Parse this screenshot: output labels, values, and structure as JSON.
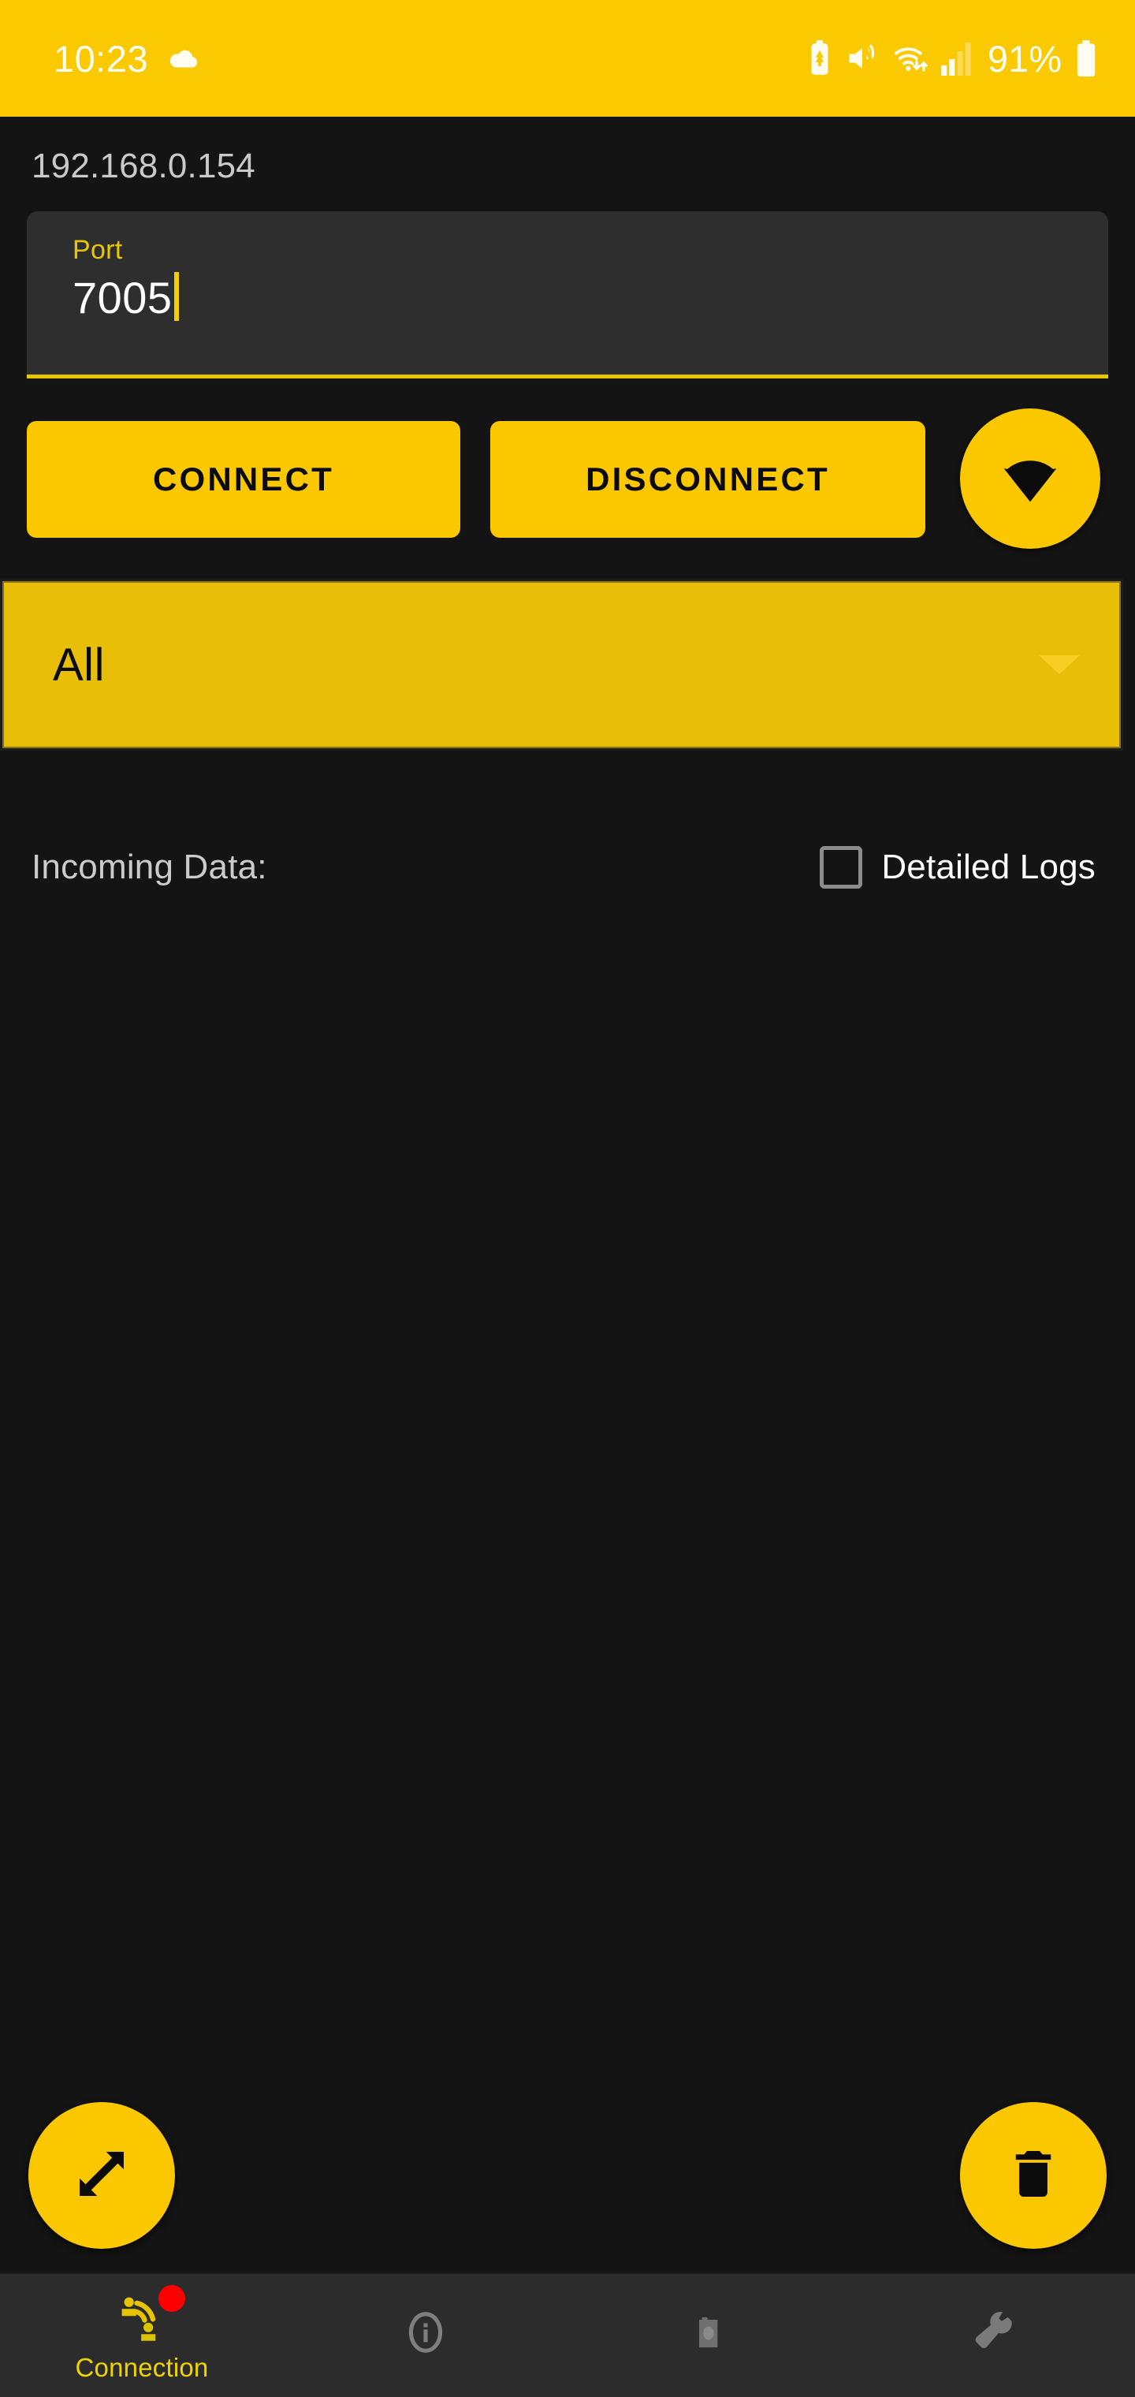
{
  "statusbar": {
    "time": "10:23",
    "battery_percent": "91%",
    "icons": {
      "weather": "cloud-icon",
      "battery_saver": "battery-saver-icon",
      "sound": "mute-vibrate-icon",
      "wifi": "wifi-transfer-icon",
      "signal": "signal-bars-icon",
      "battery": "battery-icon"
    },
    "bg_color": "#FBC900",
    "fg_color": "#FFFDF2"
  },
  "connection": {
    "ip_address": "192.168.0.154",
    "port_field": {
      "label": "Port",
      "value": "7005",
      "placeholder": "Port"
    },
    "buttons": {
      "connect": "CONNECT",
      "disconnect": "DISCONNECT",
      "wifi_fab": "wifi-icon"
    },
    "filter_spinner": {
      "selected": "All",
      "options": [
        "All"
      ]
    }
  },
  "data_panel": {
    "header_label": "Incoming Data:",
    "detailed_logs_label": "Detailed Logs",
    "detailed_logs_checked": false,
    "log_lines": []
  },
  "fabs": {
    "expand": "expand-icon",
    "clear": "trash-icon"
  },
  "bottom_nav": {
    "items": [
      {
        "label": "Connection",
        "icon": "connection-icon",
        "active": true,
        "badge": true
      },
      {
        "label": "",
        "icon": "info-icon",
        "active": false,
        "badge": false
      },
      {
        "label": "",
        "icon": "camera-icon",
        "active": false,
        "badge": false
      },
      {
        "label": "",
        "icon": "wrench-icon",
        "active": false,
        "badge": false
      }
    ]
  },
  "theme": {
    "accent": "#FBC800",
    "accent_dark": "#E8BE08",
    "background": "#141414",
    "surface": "#2E2E2E",
    "nav_background": "#2C2C2C",
    "badge_red": "#FF0000"
  }
}
